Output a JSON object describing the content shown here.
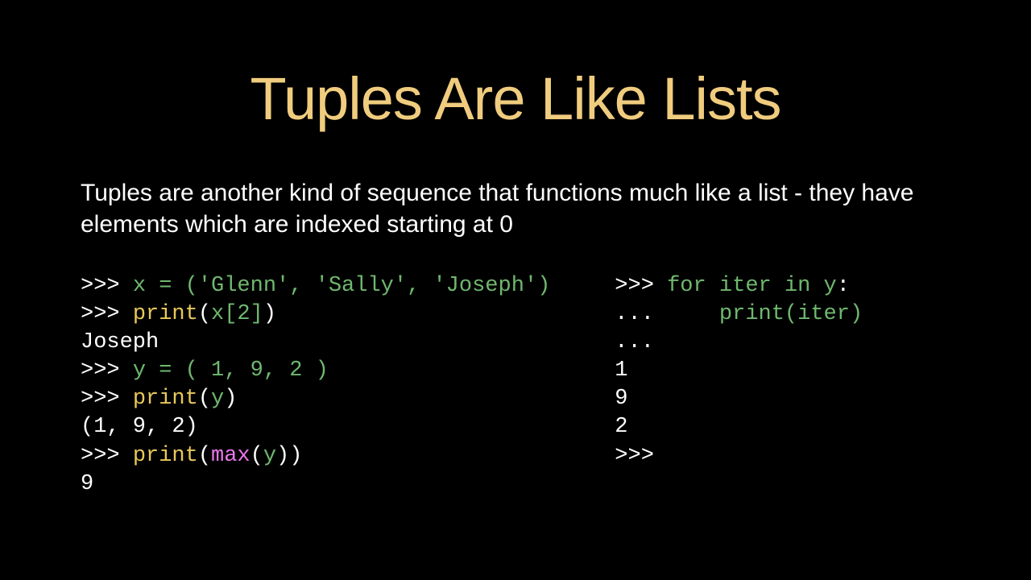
{
  "title": "Tuples Are Like Lists",
  "body": "Tuples are another kind of sequence that functions much like a list - they have elements which are indexed starting at 0",
  "code_left": {
    "l1p1": ">>> ",
    "l1p2": "x = ('Glenn', 'Sally', 'Joseph')",
    "l2p1": ">>> ",
    "l2p2": "print",
    "l2p3": "(",
    "l2p4": "x[2]",
    "l2p5": ")",
    "l3": "Joseph",
    "l4p1": ">>> ",
    "l4p2": "y = ( 1, 9, 2 )",
    "l5p1": ">>> ",
    "l5p2": "print",
    "l5p3": "(",
    "l5p4": "y",
    "l5p5": ")",
    "l6": "(1, 9, 2)",
    "l7p1": ">>> ",
    "l7p2": "print",
    "l7p3": "(",
    "l7p4": "max",
    "l7p5": "(",
    "l7p6": "y",
    "l7p7": "))",
    "l8": "9"
  },
  "code_right": {
    "l1p1": ">>> ",
    "l1p2": "for iter in y",
    "l1p3": ":",
    "l2p1": "... ",
    "l2p2": "    print(iter)",
    "l3": "... ",
    "l4": "1",
    "l5": "9",
    "l6": "2",
    "l7": ">>>"
  }
}
